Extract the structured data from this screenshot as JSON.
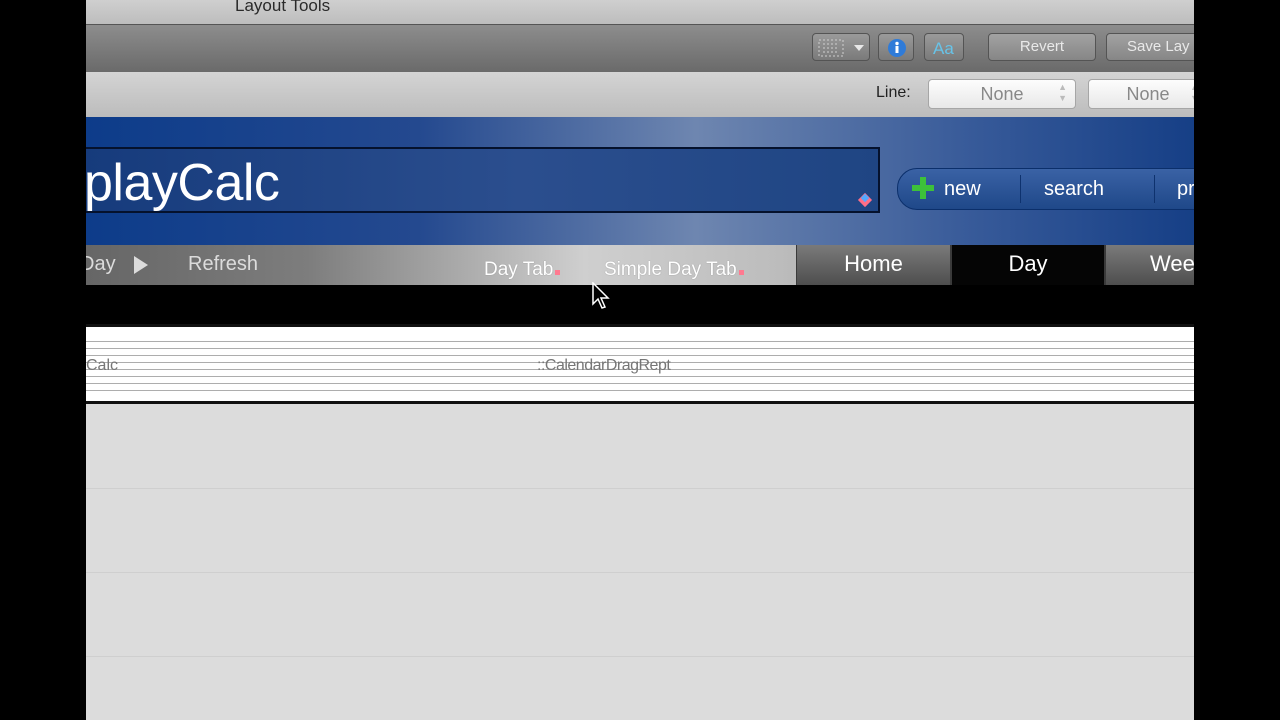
{
  "window": {
    "title": "Layout Tools"
  },
  "toolbar": {
    "revert_label": "Revert",
    "save_label": "Save Lay"
  },
  "formatbar": {
    "line_label": "Line:",
    "line_color_value": "None",
    "line_width_value": "None"
  },
  "header": {
    "title": "playCalc",
    "buttons": {
      "new": "new",
      "search": "search",
      "print": "pr"
    }
  },
  "nav": {
    "prev_label": "Day",
    "refresh_label": "Refresh",
    "tab_labels": [
      "Day Tab",
      "Simple Day Tab"
    ],
    "tabs": [
      {
        "label": "Home",
        "active": false
      },
      {
        "label": "Day",
        "active": true
      },
      {
        "label": "Wee",
        "active": false
      }
    ]
  },
  "part": {
    "left_text": "Calc",
    "center_text": "::CalendarDragRept"
  },
  "colors": {
    "header_blue": "#24498f",
    "active_tab": "#050505",
    "plus_green": "#3dc13a"
  }
}
